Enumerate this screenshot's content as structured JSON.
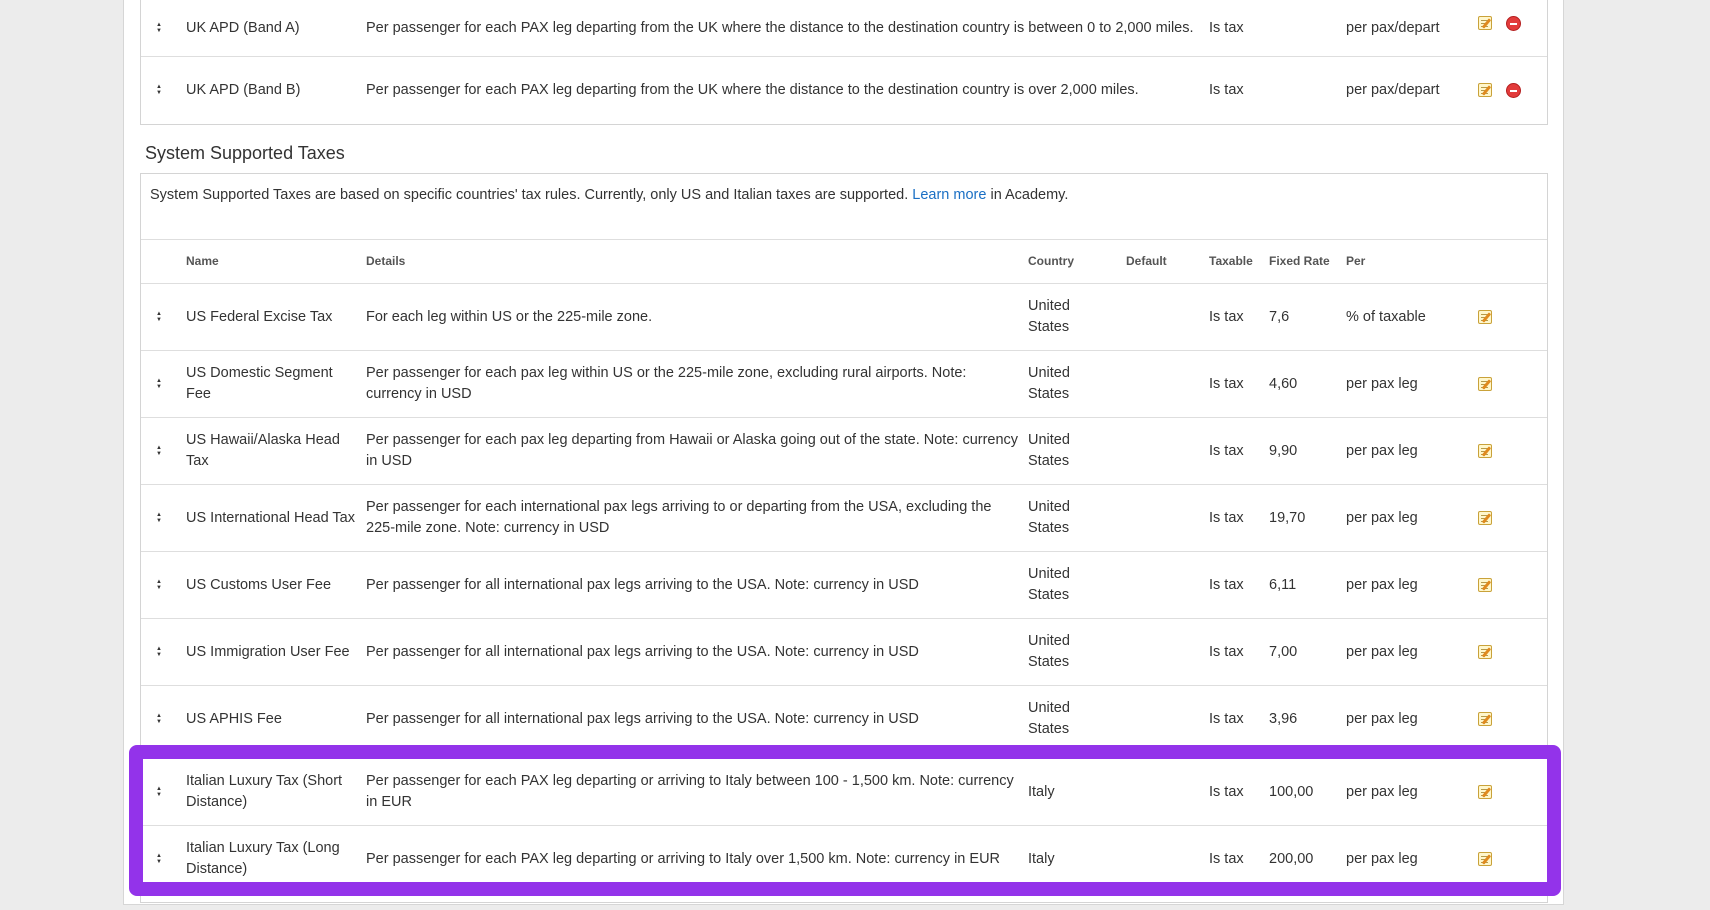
{
  "top_rows": [
    {
      "name": "UK APD (Band A)",
      "details": "Per passenger for each PAX leg departing from the UK where the distance to the destination country is between 0 to 2,000 miles.",
      "taxable": "Is tax",
      "per": "per pax/depart"
    },
    {
      "name": "UK APD (Band B)",
      "details": "Per passenger for each PAX leg departing from the UK where the distance to the destination country is over 2,000 miles.",
      "taxable": "Is tax",
      "per": "per pax/depart"
    }
  ],
  "system_section": {
    "title": "System Supported Taxes",
    "description_before": "System Supported Taxes are based on specific countries' tax rules. Currently, only US and Italian taxes are supported.",
    "learn_more": "Learn more",
    "description_after": "in Academy."
  },
  "columns": {
    "name": "Name",
    "details": "Details",
    "country": "Country",
    "default": "Default",
    "taxable": "Taxable",
    "fixed_rate": "Fixed Rate",
    "per": "Per"
  },
  "system_rows": [
    {
      "name": "US Federal Excise Tax",
      "details": "For each leg within US or the 225-mile zone.",
      "country": "United States",
      "taxable": "Is tax",
      "rate": "7,6",
      "per": "% of taxable"
    },
    {
      "name": "US Domestic Segment Fee",
      "details": "Per passenger for each pax leg within US or the 225-mile zone, excluding rural airports. Note: currency in USD",
      "country": "United States",
      "taxable": "Is tax",
      "rate": "4,60",
      "per": "per pax leg"
    },
    {
      "name": "US Hawaii/Alaska Head Tax",
      "details": "Per passenger for each pax leg departing from Hawaii or Alaska going out of the state. Note: currency in USD",
      "country": "United States",
      "taxable": "Is tax",
      "rate": "9,90",
      "per": "per pax leg"
    },
    {
      "name": "US International Head Tax",
      "details": "Per passenger for each international pax legs arriving to or departing from the USA, excluding the 225-mile zone. Note: currency in USD",
      "country": "United States",
      "taxable": "Is tax",
      "rate": "19,70",
      "per": "per pax leg"
    },
    {
      "name": "US Customs User Fee",
      "details": "Per passenger for all international pax legs arriving to the USA. Note: currency in USD",
      "country": "United States",
      "taxable": "Is tax",
      "rate": "6,11",
      "per": "per pax leg"
    },
    {
      "name": "US Immigration User Fee",
      "details": "Per passenger for all international pax legs arriving to the USA. Note: currency in USD",
      "country": "United States",
      "taxable": "Is tax",
      "rate": "7,00",
      "per": "per pax leg"
    },
    {
      "name": "US APHIS Fee",
      "details": "Per passenger for all international pax legs arriving to the USA. Note: currency in USD",
      "country": "United States",
      "taxable": "Is tax",
      "rate": "3,96",
      "per": "per pax leg"
    },
    {
      "name": "Italian Luxury Tax (Short Distance)",
      "details": "Per passenger for each PAX leg departing or arriving to Italy between 100 - 1,500 km. Note: currency in EUR",
      "country": "Italy",
      "taxable": "Is tax",
      "rate": "100,00",
      "per": "per pax leg"
    },
    {
      "name": "Italian Luxury Tax (Long Distance)",
      "details": "Per passenger for each PAX leg departing or arriving to Italy over 1,500 km. Note: currency in EUR",
      "country": "Italy",
      "taxable": "Is tax",
      "rate": "200,00",
      "per": "per pax leg"
    }
  ],
  "icons": {
    "sort": "sort-arrows-icon",
    "edit": "edit-pencil-icon",
    "delete": "delete-minus-icon"
  },
  "colors": {
    "highlight": "#9333ea",
    "link": "#1a6fc4",
    "delete": "#e23b3b"
  }
}
